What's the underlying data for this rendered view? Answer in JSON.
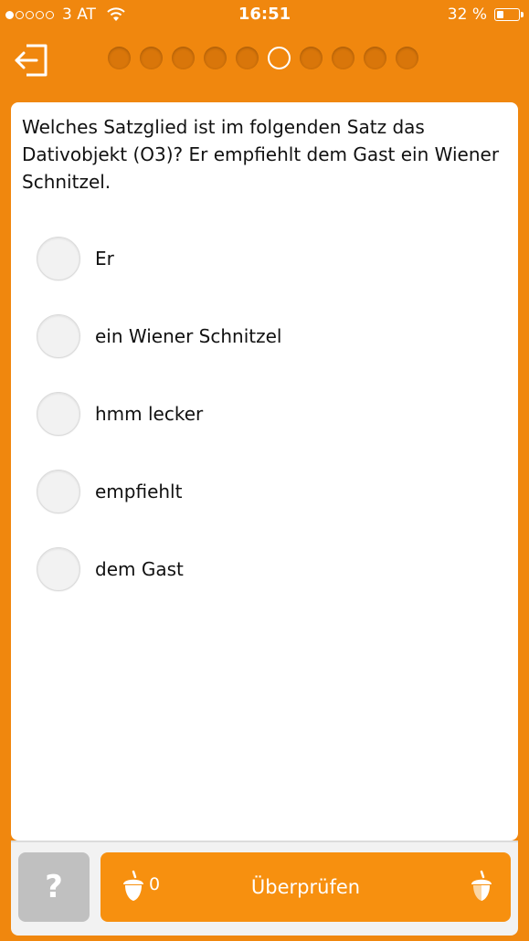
{
  "status_bar": {
    "carrier": "3 AT",
    "time": "16:51",
    "battery": "32 %",
    "battery_level": 0.32,
    "signal_bars": 1
  },
  "nav": {
    "exit_icon": "exit-arrow-icon",
    "progress_total": 10,
    "progress_current": 6
  },
  "question": {
    "text": "Welches Satzglied ist im folgenden Satz das Dativobjekt (O3)?    Er empfiehlt dem Gast ein Wiener Schnitzel."
  },
  "options": [
    {
      "label": "Er"
    },
    {
      "label": "ein Wiener Schnitzel"
    },
    {
      "label": "hmm lecker"
    },
    {
      "label": "empfiehlt"
    },
    {
      "label": "dem Gast"
    }
  ],
  "bottom": {
    "help_label": "?",
    "score": "0",
    "check_label": "Überprüfen",
    "icons": [
      "acorn-icon",
      "acorn-half-icon"
    ]
  },
  "colors": {
    "brand_orange": "#F0870E",
    "button_orange": "#F7900F",
    "help_grey": "#C0C0C0"
  }
}
